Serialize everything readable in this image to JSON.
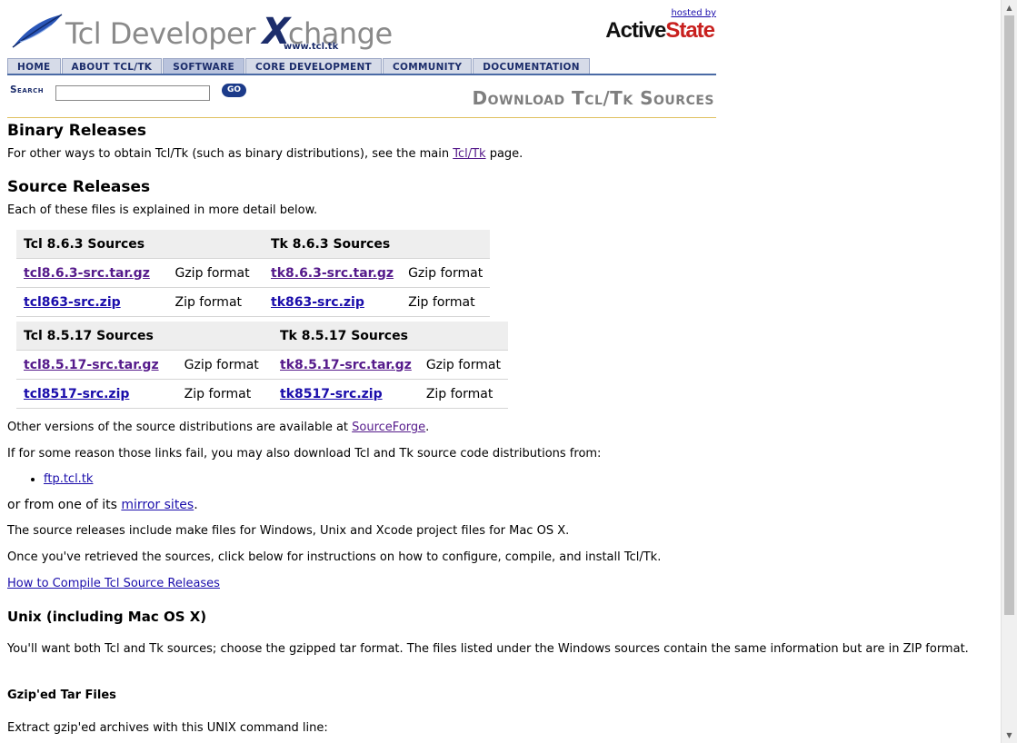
{
  "header": {
    "logo_text_pre": "Tcl Developer ",
    "logo_x": "X",
    "logo_text_post": "change",
    "logo_url": "www.tcl.tk",
    "hosted_by": "hosted by",
    "active": "Active",
    "state": "State"
  },
  "nav": [
    "HOME",
    "ABOUT TCL/TK",
    "SOFTWARE",
    "CORE DEVELOPMENT",
    "COMMUNITY",
    "DOCUMENTATION"
  ],
  "search": {
    "label": "Search",
    "value": "",
    "go": "GO"
  },
  "page_heading": "Download Tcl/Tk Sources",
  "binary": {
    "heading": "Binary Releases",
    "text_pre": "For other ways to obtain Tcl/Tk (such as binary distributions), see the main ",
    "link": "Tcl/Tk",
    "text_post": " page."
  },
  "source": {
    "heading": "Source Releases",
    "intro": "Each of these files is explained in more detail below."
  },
  "tables": [
    {
      "tcl_header": "Tcl 8.6.3 Sources",
      "tk_header": "Tk 8.6.3 Sources",
      "rows": [
        {
          "tcl_file": "tcl8.6.3-src.tar.gz",
          "tcl_fmt": "Gzip format",
          "tk_file": "tk8.6.3-src.tar.gz",
          "tk_fmt": "Gzip format"
        },
        {
          "tcl_file": "tcl863-src.zip",
          "tcl_fmt": "Zip format",
          "tk_file": "tk863-src.zip",
          "tk_fmt": "Zip format"
        }
      ]
    },
    {
      "tcl_header": "Tcl 8.5.17 Sources",
      "tk_header": "Tk 8.5.17 Sources",
      "rows": [
        {
          "tcl_file": "tcl8.5.17-src.tar.gz",
          "tcl_fmt": "Gzip format",
          "tk_file": "tk8.5.17-src.tar.gz",
          "tk_fmt": "Gzip format"
        },
        {
          "tcl_file": "tcl8517-src.zip",
          "tcl_fmt": "Zip format",
          "tk_file": "tk8517-src.zip",
          "tk_fmt": "Zip format"
        }
      ]
    }
  ],
  "other_versions": {
    "pre": "Other versions of the source distributions are available at ",
    "link": "SourceForge",
    "post": "."
  },
  "fail_text": "If for some reason those links fail, you may also download Tcl and Tk source code distributions from:",
  "ftp_link": "ftp.tcl.tk",
  "mirror": {
    "pre": "or from one of its ",
    "link": "mirror sites",
    "post": "."
  },
  "make_text": "The source releases include make files for Windows, Unix and Xcode project files for Mac OS X.",
  "once_text": "Once you've retrieved the sources, click below for instructions on how to configure, compile, and install Tcl/Tk.",
  "how_link": "How to Compile Tcl Source Releases",
  "unix_heading": "Unix (including Mac OS X)",
  "unix_text": "You'll want both Tcl and Tk sources; choose the gzipped tar format. The files listed under the Windows sources contain the same information but are in ZIP format.",
  "gz_heading": "Gzip'ed Tar Files",
  "extract_text": "Extract gzip'ed archives with this UNIX command line:"
}
